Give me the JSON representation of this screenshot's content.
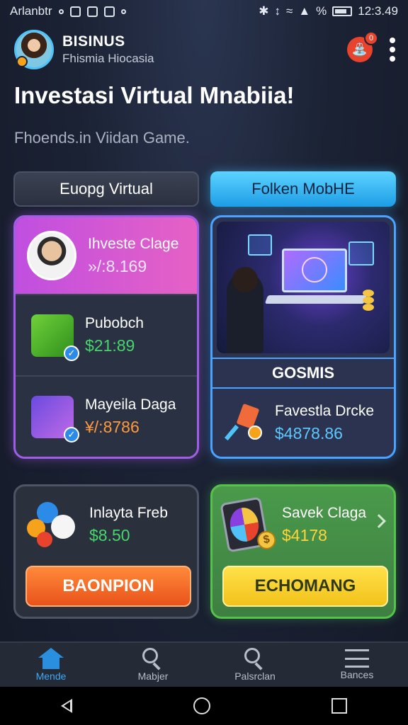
{
  "status_bar": {
    "carrier": "Arlanbtr",
    "battery_percent_glyph": "%",
    "time": "12:3.49"
  },
  "header": {
    "brand_name": "BISINUS",
    "brand_sub": "Fhismia Hiocasia",
    "notification_count": "0"
  },
  "hero": {
    "title": "Investasi Virtual Mnabiia!",
    "subtitle": "Fhoends.in Viidan Game."
  },
  "tabs": [
    {
      "label": "Euopg Virtual",
      "active": false
    },
    {
      "label": "Folken MobHE",
      "active": true
    }
  ],
  "left_card": {
    "items": [
      {
        "title": "Ihveste Clage",
        "value": "»/:8.169"
      },
      {
        "title": "Pubobch",
        "value": "$21:89"
      },
      {
        "title": "Mayeila Daga",
        "value": "¥/:8786"
      }
    ]
  },
  "right_card": {
    "section_label": "GOSMIS",
    "item": {
      "title": "Favestla Drcke",
      "value": "$4878.86"
    }
  },
  "bottom_left_card": {
    "title": "Inlayta Freb",
    "value": "$8.50",
    "button_label": "BAONPION"
  },
  "bottom_right_card": {
    "title": "Savek Claga",
    "value": "$4178",
    "button_label": "ECHOMANG"
  },
  "bottom_nav": [
    {
      "label": "Mende",
      "icon": "home-icon",
      "active": true
    },
    {
      "label": "Mabjer",
      "icon": "search-icon",
      "active": false
    },
    {
      "label": "Palsrclan",
      "icon": "search-icon",
      "active": false
    },
    {
      "label": "Bances",
      "icon": "menu-icon",
      "active": false
    }
  ],
  "colors": {
    "accent_blue": "#3fa9f5",
    "accent_purple": "#a05de8",
    "accent_green": "#55c24b",
    "button_orange": "#e9521a",
    "button_yellow": "#f2c21a"
  }
}
